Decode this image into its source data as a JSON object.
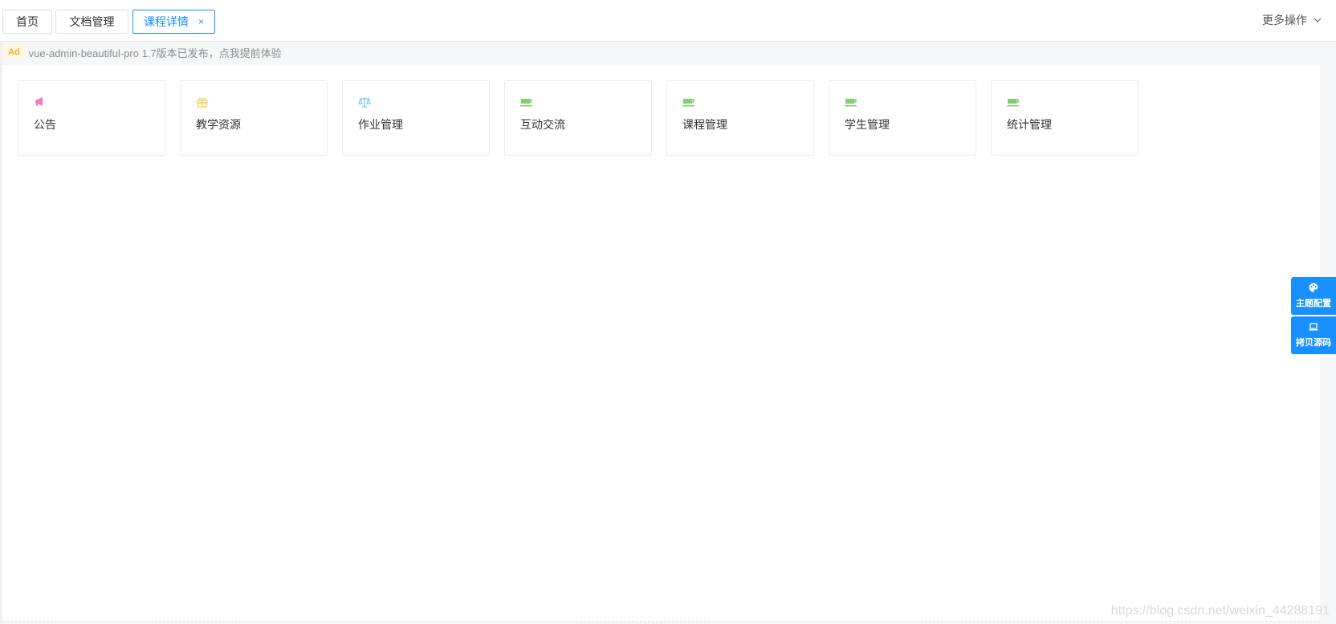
{
  "tabs": [
    {
      "label": "首页"
    },
    {
      "label": "文档管理"
    },
    {
      "label": "课程详情",
      "close": "×"
    }
  ],
  "more_ops": {
    "label": "更多操作",
    "icon": "chevron-down-icon"
  },
  "ad": {
    "badge": "Ad",
    "text": "vue-admin-beautiful-pro 1.7版本已发布，点我提前体验"
  },
  "cards": [
    {
      "label": "公告",
      "icon": "bullhorn-icon",
      "color": "#f57ab5"
    },
    {
      "label": "教学资源",
      "icon": "gift-icon",
      "color": "#f5d36a"
    },
    {
      "label": "作业管理",
      "icon": "balance-scale-icon",
      "color": "#7ec9f0"
    },
    {
      "label": "互动交流",
      "icon": "coffee-icon",
      "color": "#7ed070"
    },
    {
      "label": "课程管理",
      "icon": "coffee-icon",
      "color": "#7ed070"
    },
    {
      "label": "学生管理",
      "icon": "coffee-icon",
      "color": "#7ed070"
    },
    {
      "label": "统计管理",
      "icon": "coffee-icon",
      "color": "#7ed070"
    }
  ],
  "side_panel": [
    {
      "label": "主题配置",
      "icon": "palette-icon"
    },
    {
      "label": "拷贝源码",
      "icon": "laptop-icon"
    }
  ],
  "watermark": "https://blog.csdn.net/weixin_44288191",
  "colors": {
    "accent": "#1890ff"
  }
}
